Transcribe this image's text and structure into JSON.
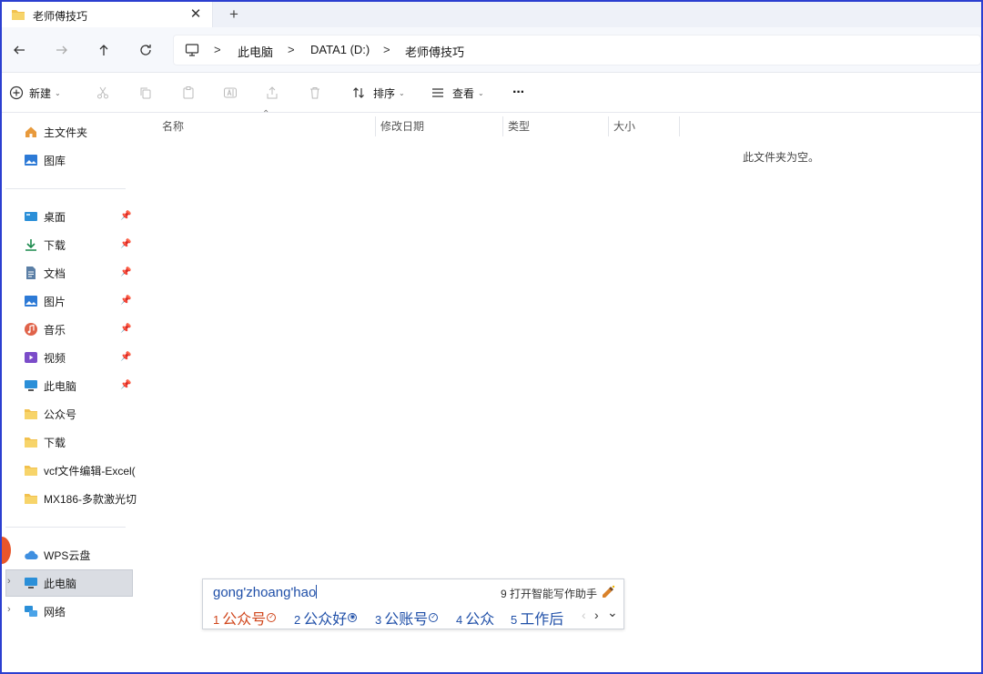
{
  "window": {
    "tab_title": "老师傅技巧",
    "close_glyph": "✕",
    "new_tab_glyph": "+"
  },
  "address": {
    "crumbs": [
      "此电脑",
      "DATA1 (D:)",
      "老师傅技巧"
    ],
    "separator": ">"
  },
  "toolbar": {
    "new_label": "新建",
    "sort_label": "排序",
    "view_label": "查看",
    "more_label": "···"
  },
  "sidebar": {
    "top_items": [
      {
        "label": "主文件夹",
        "icon": "home-icon"
      },
      {
        "label": "图库",
        "icon": "gallery-icon"
      }
    ],
    "pinned_items": [
      {
        "label": "桌面",
        "icon": "desktop-icon"
      },
      {
        "label": "下载",
        "icon": "download-icon"
      },
      {
        "label": "文档",
        "icon": "document-icon"
      },
      {
        "label": "图片",
        "icon": "pictures-icon"
      },
      {
        "label": "音乐",
        "icon": "music-icon"
      },
      {
        "label": "视频",
        "icon": "video-icon"
      },
      {
        "label": "此电脑",
        "icon": "pc-icon"
      }
    ],
    "folder_items": [
      {
        "label": "公众号"
      },
      {
        "label": "下载"
      },
      {
        "label": "vcf文件编辑-Excel("
      },
      {
        "label": "MX186-多款激光切"
      }
    ],
    "bottom_items": [
      {
        "label": "WPS云盘",
        "icon": "cloud-icon"
      },
      {
        "label": "此电脑",
        "icon": "pc-icon",
        "selected": true
      },
      {
        "label": "网络",
        "icon": "network-icon"
      }
    ]
  },
  "columns": [
    "名称",
    "修改日期",
    "类型",
    "大小"
  ],
  "empty_message": "此文件夹为空。",
  "ime": {
    "composition": "gong'zhoang'hao",
    "assistant_hint": "9 打开智能写作助手",
    "candidates": [
      {
        "num": "1",
        "text": "公众号",
        "badge": "✓"
      },
      {
        "num": "2",
        "text": "公众好",
        "badge": "◉"
      },
      {
        "num": "3",
        "text": "公账号",
        "badge": "✓"
      },
      {
        "num": "4",
        "text": "公众",
        "badge": ""
      },
      {
        "num": "5",
        "text": "工作后",
        "badge": ""
      }
    ],
    "prev_glyph": "‹",
    "next_glyph": "›",
    "expand_glyph": "⌄"
  },
  "colors": {
    "accent": "#1f4fa8",
    "first_candidate": "#d0451b",
    "folder": "#f2c14e",
    "frame": "#2b3fd0"
  }
}
